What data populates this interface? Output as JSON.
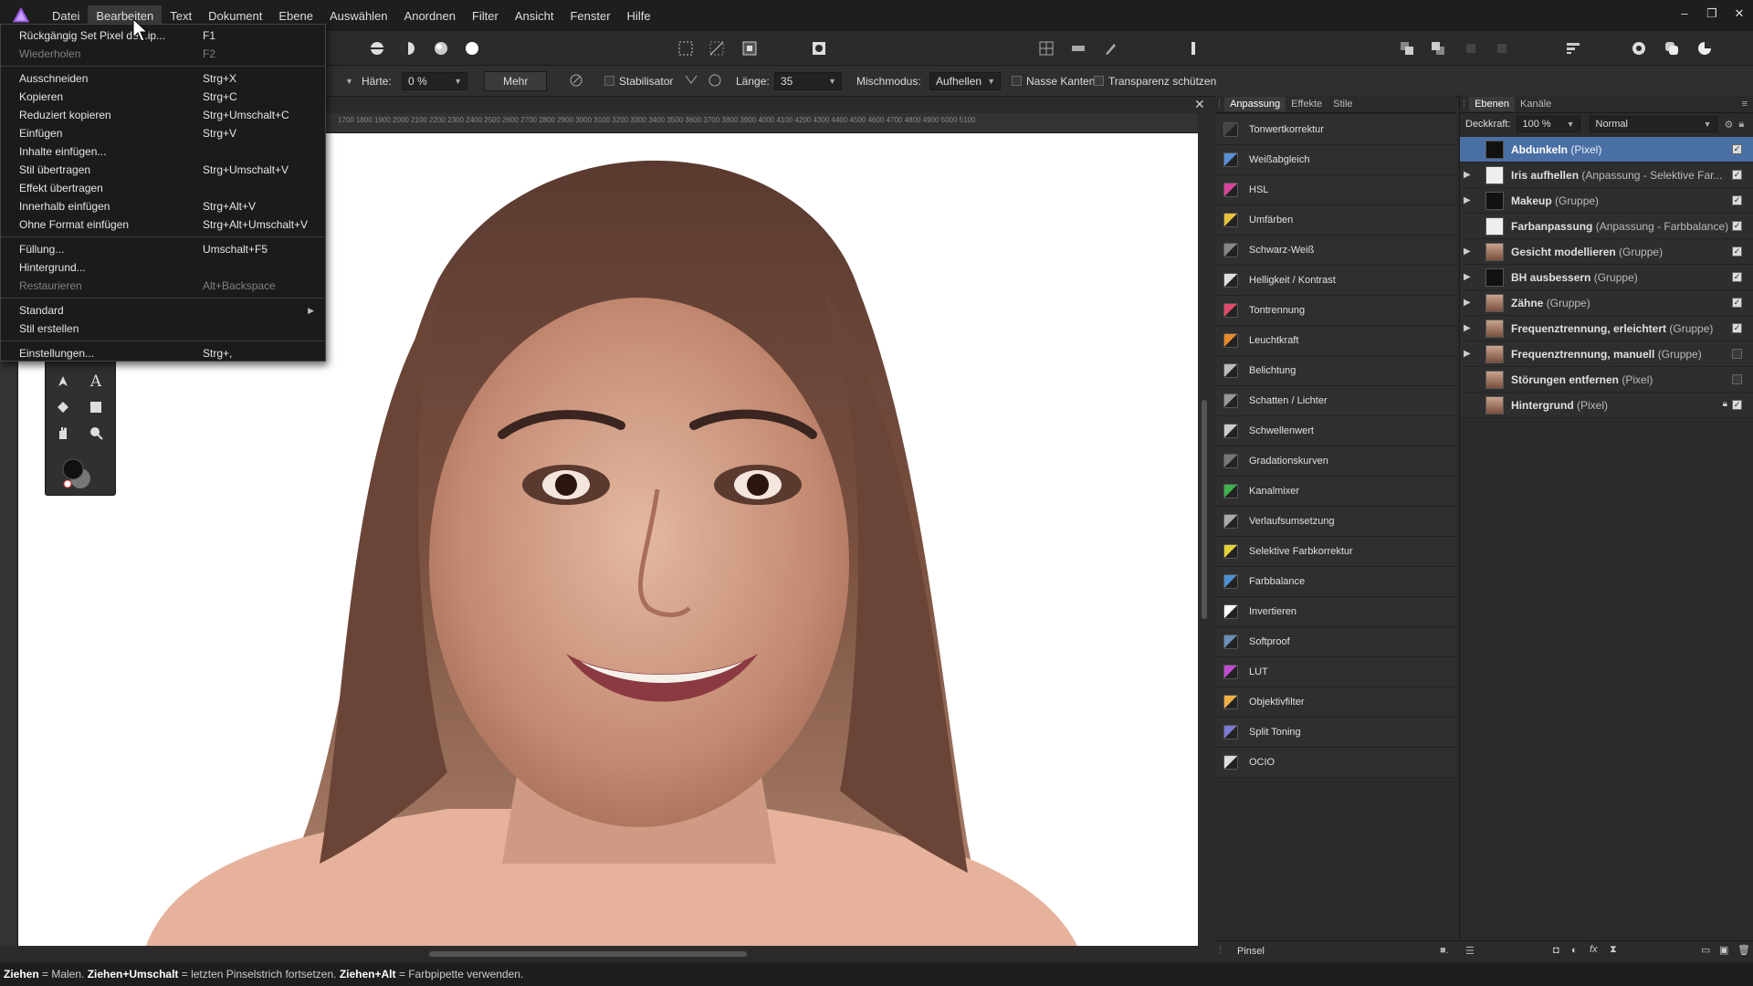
{
  "menubar": {
    "items": [
      "Datei",
      "Bearbeiten",
      "Text",
      "Dokument",
      "Ebene",
      "Auswählen",
      "Anordnen",
      "Filter",
      "Ansicht",
      "Fenster",
      "Hilfe"
    ],
    "active_index": 1,
    "window_controls": [
      "–",
      "❐",
      "✕"
    ]
  },
  "context_toolbar": {
    "haerte_label": "Härte:",
    "haerte_value": "0 %",
    "mehr_label": "Mehr",
    "stabilisator_label": "Stabilisator",
    "laenge_label": "Länge:",
    "laenge_value": "35",
    "mischmodus_label": "Mischmodus:",
    "mischmodus_value": "Aufhellen",
    "nasse_kanten_label": "Nasse Kanten",
    "transparenz_label": "Transparenz schützen"
  },
  "ruler": {
    "labels": "1700  1800  1900  2000  2100  2200  2300  2400  2500  2600  2700  2800  2900  3000  3100  3200  3300  3400  3500  3600  3700  3800  3900  4000  4100  4200  4300  4400  4500  4600  4700  4800  4900  5000  5100"
  },
  "edit_menu": {
    "items": [
      {
        "label": "Rückgängig Set Pixel de...ip...",
        "shortcut": "F1",
        "disabled": false
      },
      {
        "label": "Wiederholen",
        "shortcut": "F2",
        "disabled": true
      },
      {
        "sep": true
      },
      {
        "label": "Ausschneiden",
        "shortcut": "Strg+X",
        "disabled": false
      },
      {
        "label": "Kopieren",
        "shortcut": "Strg+C",
        "disabled": false
      },
      {
        "label": "Reduziert kopieren",
        "shortcut": "Strg+Umschalt+C",
        "disabled": false
      },
      {
        "label": "Einfügen",
        "shortcut": "Strg+V",
        "disabled": false
      },
      {
        "label": "Inhalte einfügen...",
        "shortcut": "",
        "disabled": false
      },
      {
        "label": "Stil übertragen",
        "shortcut": "Strg+Umschalt+V",
        "disabled": false
      },
      {
        "label": "Effekt übertragen",
        "shortcut": "",
        "disabled": false
      },
      {
        "label": "Innerhalb einfügen",
        "shortcut": "Strg+Alt+V",
        "disabled": false
      },
      {
        "label": "Ohne Format einfügen",
        "shortcut": "Strg+Alt+Umschalt+V",
        "disabled": false
      },
      {
        "sep": true
      },
      {
        "label": "Füllung...",
        "shortcut": "Umschalt+F5",
        "disabled": false
      },
      {
        "label": "Hintergrund...",
        "shortcut": "",
        "disabled": false
      },
      {
        "label": "Restaurieren",
        "shortcut": "Alt+Backspace",
        "disabled": true
      },
      {
        "sep": true
      },
      {
        "label": "Standard",
        "shortcut": "",
        "disabled": false,
        "submenu": true
      },
      {
        "label": "Stil erstellen",
        "shortcut": "",
        "disabled": false
      },
      {
        "sep": true
      },
      {
        "label": "Einstellungen...",
        "shortcut": "Strg+,",
        "disabled": false
      }
    ]
  },
  "adjustments_panel": {
    "tabs": [
      "Anpassung",
      "Effekte",
      "Stile"
    ],
    "items": [
      {
        "label": "Tonwertkorrektur",
        "icon": "levels-icon",
        "color": "#444444"
      },
      {
        "label": "Weißabgleich",
        "icon": "white-balance-icon",
        "color": "#5b8fd6"
      },
      {
        "label": "HSL",
        "icon": "hsl-icon",
        "color": "#d6459b"
      },
      {
        "label": "Umfärben",
        "icon": "recolor-icon",
        "color": "#e8c23b"
      },
      {
        "label": "Schwarz-Weiß",
        "icon": "black-white-icon",
        "color": "#888888"
      },
      {
        "label": "Helligkeit / Kontrast",
        "icon": "brightness-contrast-icon",
        "color": "#dddddd"
      },
      {
        "label": "Tontrennung",
        "icon": "posterize-icon",
        "color": "#e04a6a"
      },
      {
        "label": "Leuchtkraft",
        "icon": "vibrance-icon",
        "color": "#e88b2a"
      },
      {
        "label": "Belichtung",
        "icon": "exposure-icon",
        "color": "#bbbbbb"
      },
      {
        "label": "Schatten / Lichter",
        "icon": "shadows-highlights-icon",
        "color": "#999999"
      },
      {
        "label": "Schwellenwert",
        "icon": "threshold-icon",
        "color": "#cccccc"
      },
      {
        "label": "Gradationskurven",
        "icon": "curves-icon",
        "color": "#777777"
      },
      {
        "label": "Kanalmixer",
        "icon": "channel-mixer-icon",
        "color": "#3fb04a"
      },
      {
        "label": "Verlaufsumsetzung",
        "icon": "gradient-map-icon",
        "color": "#aaaaaa"
      },
      {
        "label": "Selektive Farbkorrektur",
        "icon": "selective-color-icon",
        "color": "#e6d33a"
      },
      {
        "label": "Farbbalance",
        "icon": "color-balance-icon",
        "color": "#4a90d0"
      },
      {
        "label": "Invertieren",
        "icon": "invert-icon",
        "color": "#ffffff"
      },
      {
        "label": "Softproof",
        "icon": "soft-proof-icon",
        "color": "#6a8fb8"
      },
      {
        "label": "LUT",
        "icon": "lut-icon",
        "color": "#c04ad0"
      },
      {
        "label": "Objektivfilter",
        "icon": "lens-filter-icon",
        "color": "#f0b048"
      },
      {
        "label": "Split Toning",
        "icon": "split-toning-icon",
        "color": "#7a7ad0"
      },
      {
        "label": "OCIO",
        "icon": "ocio-icon",
        "color": "#dddddd"
      }
    ]
  },
  "layers_panel": {
    "tabs": [
      "Ebenen",
      "Kanäle"
    ],
    "opacity_label": "Deckkraft:",
    "opacity_value": "100 %",
    "blend_mode": "Normal",
    "layers": [
      {
        "name": "Abdunkeln",
        "kind": "(Pixel)",
        "expandable": false,
        "selected": true,
        "visible": true,
        "thumb": "dark",
        "locked": false
      },
      {
        "name": "Iris aufhellen",
        "kind": "(Anpassung - Selektive Far...",
        "expandable": true,
        "selected": false,
        "visible": true,
        "thumb": "white",
        "locked": false
      },
      {
        "name": "Makeup",
        "kind": "(Gruppe)",
        "expandable": true,
        "selected": false,
        "visible": true,
        "thumb": "dark",
        "locked": false
      },
      {
        "name": "Farbanpassung",
        "kind": "(Anpassung - Farbbalance)",
        "expandable": false,
        "selected": false,
        "visible": true,
        "thumb": "white",
        "locked": false
      },
      {
        "name": "Gesicht modellieren",
        "kind": "(Gruppe)",
        "expandable": true,
        "selected": false,
        "visible": true,
        "thumb": "face",
        "locked": false
      },
      {
        "name": "BH ausbessern",
        "kind": "(Gruppe)",
        "expandable": true,
        "selected": false,
        "visible": true,
        "thumb": "dark",
        "locked": false
      },
      {
        "name": "Zähne",
        "kind": "(Gruppe)",
        "expandable": true,
        "selected": false,
        "visible": true,
        "thumb": "face",
        "locked": false
      },
      {
        "name": "Frequenztrennung, erleichtert",
        "kind": "(Gruppe)",
        "expandable": true,
        "selected": false,
        "visible": true,
        "thumb": "face",
        "locked": false
      },
      {
        "name": "Frequenztrennung, manuell",
        "kind": "(Gruppe)",
        "expandable": true,
        "selected": false,
        "visible": false,
        "thumb": "face",
        "locked": false
      },
      {
        "name": "Störungen entfernen",
        "kind": "(Pixel)",
        "expandable": false,
        "selected": false,
        "visible": false,
        "thumb": "face",
        "locked": false
      },
      {
        "name": "Hintergrund",
        "kind": "(Pixel)",
        "expandable": false,
        "selected": false,
        "visible": true,
        "thumb": "face",
        "locked": true
      }
    ]
  },
  "brush_panel": {
    "label": "Pinsel"
  },
  "status": {
    "k1": "Ziehen",
    "t1": " = Malen. ",
    "k2": "Ziehen",
    "k3": "+Umschalt",
    "t2": " = letzten Pinselstrich fortsetzen. ",
    "k4": "Ziehen",
    "k5": "+Alt",
    "t3": " = Farbpipette verwenden."
  },
  "colors": {
    "accent": "#4a6fa5",
    "background": "#2b2b2b",
    "menu_bg": "#1b1b1b"
  }
}
